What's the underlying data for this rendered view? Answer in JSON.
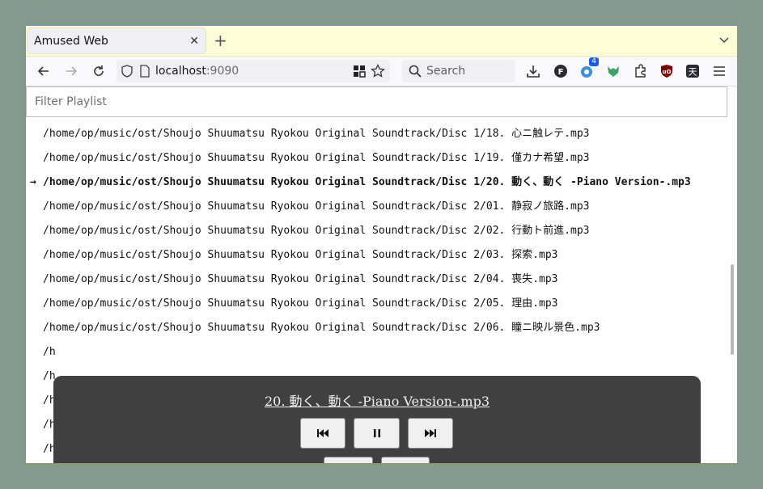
{
  "browser": {
    "tab_title": "Amused Web",
    "url_host": "localhost",
    "url_port": ":9090",
    "search_placeholder": "Search",
    "extension_badge": "4"
  },
  "filter": {
    "placeholder": "Filter Playlist"
  },
  "playlist": [
    {
      "path": "/home/op/music/ost/Shoujo Shuumatsu Ryokou Original Soundtrack/Disc 1/18. 心ニ触レテ.mp3",
      "current": false
    },
    {
      "path": "/home/op/music/ost/Shoujo Shuumatsu Ryokou Original Soundtrack/Disc 1/19. 僅カナ希望.mp3",
      "current": false
    },
    {
      "path": "/home/op/music/ost/Shoujo Shuumatsu Ryokou Original Soundtrack/Disc 1/20. 動く、動く -Piano Version-.mp3",
      "current": true
    },
    {
      "path": "/home/op/music/ost/Shoujo Shuumatsu Ryokou Original Soundtrack/Disc 2/01. 静寂ノ旅路.mp3",
      "current": false
    },
    {
      "path": "/home/op/music/ost/Shoujo Shuumatsu Ryokou Original Soundtrack/Disc 2/02. 行動ト前進.mp3",
      "current": false
    },
    {
      "path": "/home/op/music/ost/Shoujo Shuumatsu Ryokou Original Soundtrack/Disc 2/03. 探索.mp3",
      "current": false
    },
    {
      "path": "/home/op/music/ost/Shoujo Shuumatsu Ryokou Original Soundtrack/Disc 2/04. 喪失.mp3",
      "current": false
    },
    {
      "path": "/home/op/music/ost/Shoujo Shuumatsu Ryokou Original Soundtrack/Disc 2/05. 理由.mp3",
      "current": false
    },
    {
      "path": "/home/op/music/ost/Shoujo Shuumatsu Ryokou Original Soundtrack/Disc 2/06. 瞳ニ映ル景色.mp3",
      "current": false
    },
    {
      "path": "/h",
      "current": false
    },
    {
      "path": "/h",
      "current": false
    },
    {
      "path": "/h",
      "current": false
    },
    {
      "path": "/h",
      "current": false
    },
    {
      "path": "/h",
      "current": false
    }
  ],
  "current_marker": "→",
  "player": {
    "now_playing": "20. 動く、動く -Piano Version-.mp3",
    "buttons": [
      "previous",
      "pause",
      "next",
      "repeat",
      "repeat-one"
    ]
  },
  "colors": {
    "desktop": "#84998f",
    "tabbar": "#fdfdd8",
    "window_border": "#1fb6e0",
    "player_bg": "#404040",
    "accent": "#1a73e8"
  }
}
